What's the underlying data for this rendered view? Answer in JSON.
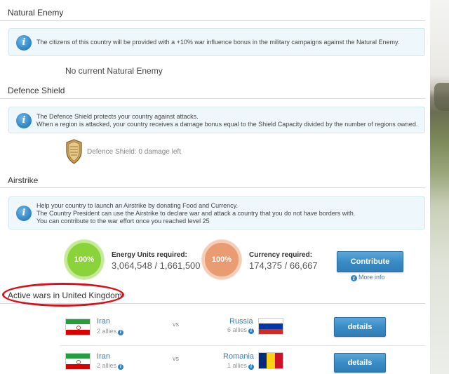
{
  "natural_enemy": {
    "title": "Natural Enemy",
    "info": "The citizens of this country will be provided with a +10% war influence bonus in the military campaigns against the Natural Enemy.",
    "status": "No current Natural Enemy"
  },
  "defence_shield": {
    "title": "Defence Shield",
    "info_line1": "The Defence Shield protects your country against attacks.",
    "info_line2": "When a region is attacked, your country receives a damage bonus equal to the Shield Capacity divided by the number of regions owned.",
    "status": "Defence Shield: 0 damage left"
  },
  "airstrike": {
    "title": "Airstrike",
    "info_line1": "Help your country to launch an Airstrike by donating Food and Currency.",
    "info_line2": "The Country President can use the Airstrike to declare war and attack a country that you do not have borders with.",
    "info_line3": "You can contribute to the war effort once you reached level 25",
    "energy": {
      "percent": "100%",
      "label": "Energy Units required:",
      "value": "3,064,548 / 1,661,500"
    },
    "currency": {
      "percent": "100%",
      "label": "Currency required:",
      "value": "174,375 / 66,667"
    },
    "contribute_label": "Contribute",
    "more_info_label": "More info"
  },
  "active_wars": {
    "title": "Active wars in United Kingdom",
    "vs_label": "vs",
    "details_label": "details",
    "rows": [
      {
        "attacker": "Iran",
        "attacker_allies": "2 allies",
        "defender": "Russia",
        "defender_allies": "6 allies"
      },
      {
        "attacker": "Iran",
        "attacker_allies": "2 allies",
        "defender": "Romania",
        "defender_allies": "1 allies"
      }
    ]
  },
  "colors": {
    "accent_blue": "#3a8cc6",
    "info_bg": "#eef7fb",
    "energy_green": "#8bd33a",
    "currency_orange": "#e99c72",
    "highlight_red": "#d8101a"
  }
}
